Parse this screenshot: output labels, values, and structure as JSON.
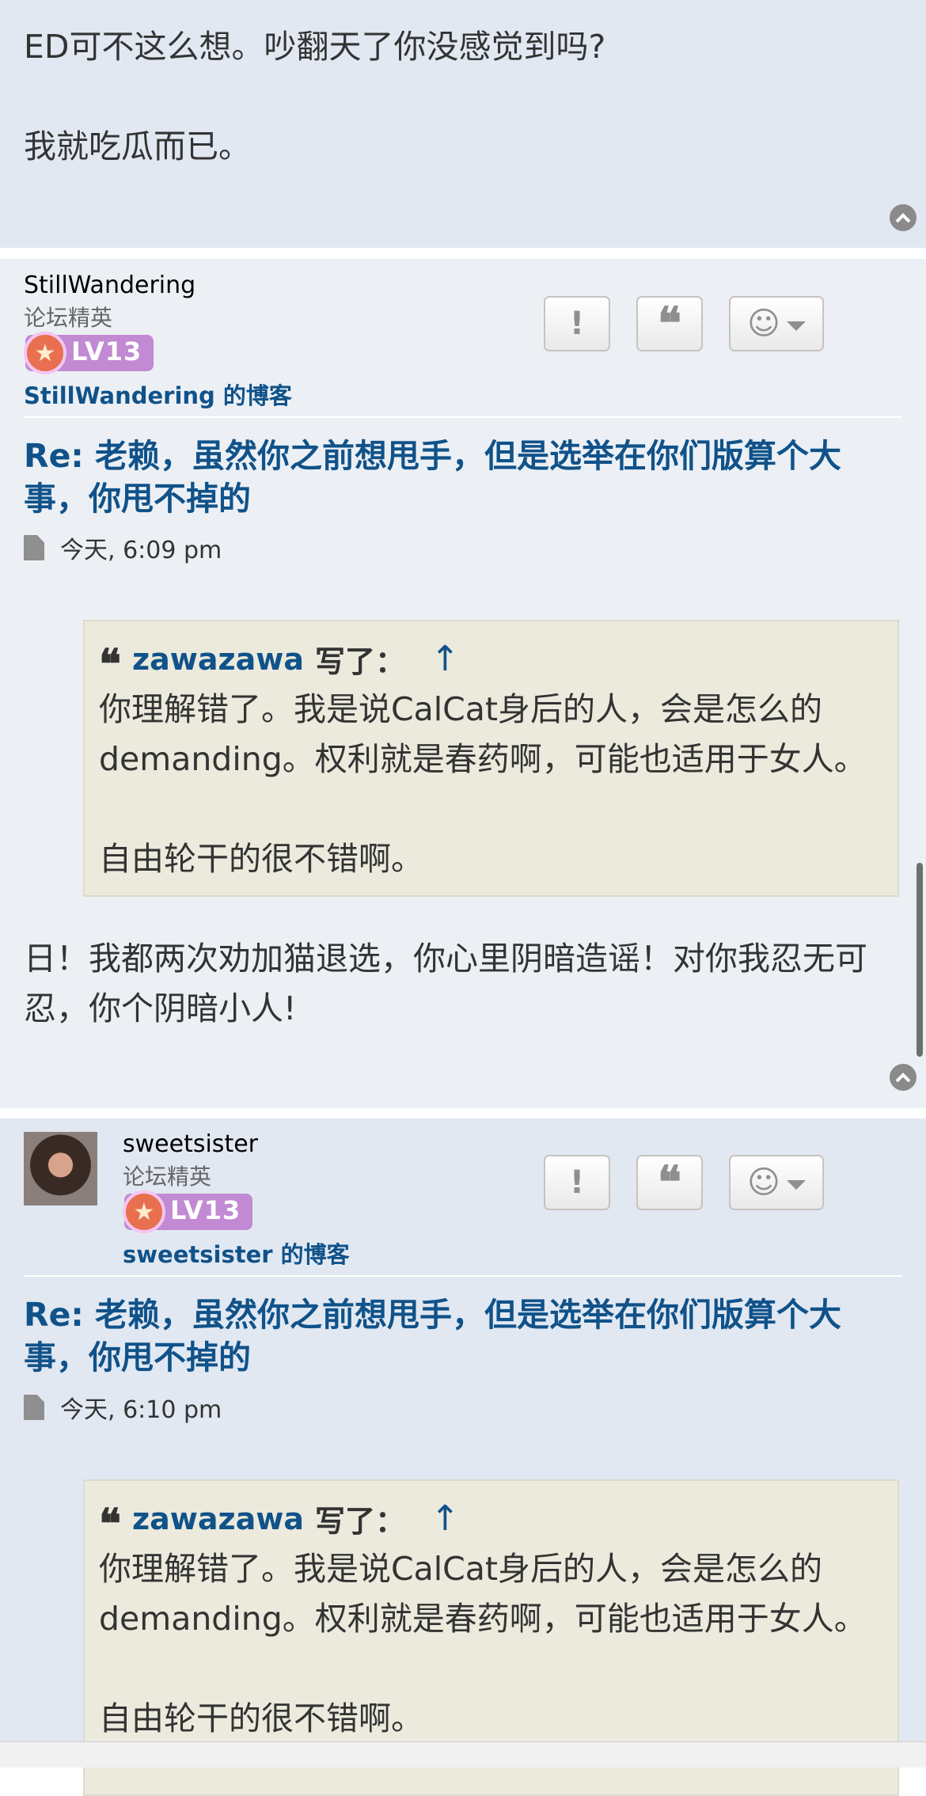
{
  "post_prev": {
    "lines": [
      "ED可不这么想。吵翻天了你没感觉到吗?",
      "",
      "我就吃瓜而已。"
    ]
  },
  "posts": [
    {
      "username": "StillWandering",
      "rank": "论坛精英",
      "level": "LV13",
      "blog_link": "StillWandering 的博客",
      "title": "Re: 老赖，虽然你之前想甩手，但是选举在你们版算个大事，你甩不掉的",
      "time": "今天, 6:09 pm",
      "quote": {
        "author": "zawazawa",
        "says": "写了：",
        "up_arrow": "↑",
        "text": "你理解错了。我是说CalCat身后的人，会是怎么的demanding。权利就是春药啊，可能也适用于女人。\n\n自由轮干的很不错啊。"
      },
      "body": "日！我都两次劝加猫退选，你心里阴暗造谣！对你我忍无可忍，你个阴暗小人!"
    },
    {
      "username": "sweetsister",
      "rank": "论坛精英",
      "level": "LV13",
      "blog_link": "sweetsister 的博客",
      "title": "Re: 老赖，虽然你之前想甩手，但是选举在你们版算个大事，你甩不掉的",
      "time": "今天, 6:10 pm",
      "quote": {
        "author": "zawazawa",
        "says": "写了：",
        "up_arrow": "↑",
        "text": "你理解错了。我是说CalCat身后的人，会是怎么的demanding。权利就是春药啊，可能也适用于女人。\n\n自由轮干的很不错啊。"
      }
    }
  ],
  "buttons": {
    "report": "!",
    "quote": "❝",
    "react": "☺"
  },
  "icons": {
    "back_to_top": "chevron-up-icon",
    "file": "file-icon",
    "quote": "quote-icon",
    "report": "exclamation-icon",
    "react": "smiley-icon"
  },
  "colors": {
    "link": "#105289",
    "post_bg_1": "#e1e8f2",
    "post_bg_2": "#ecf0f5",
    "quote_bg": "#ebeadd",
    "badge": "#c28ad3"
  }
}
